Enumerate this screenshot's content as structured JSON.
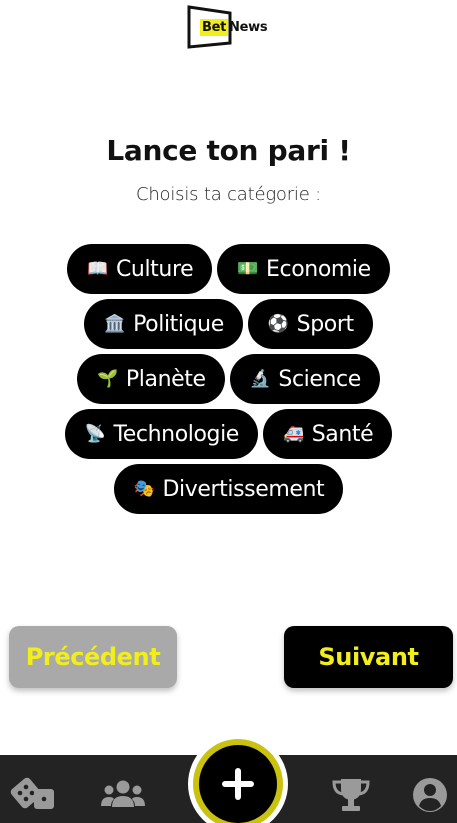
{
  "logo": {
    "bet": "Bet",
    "news": "News"
  },
  "title": "Lance ton pari !",
  "subtitle": "Choisis ta catégorie :",
  "categories": [
    {
      "emoji": "📖",
      "label": "Culture",
      "icon": "open-book-icon"
    },
    {
      "emoji": "💵",
      "label": "Economie",
      "icon": "banknote-icon"
    },
    {
      "emoji": "🏛️",
      "label": "Politique",
      "icon": "classical-building-icon"
    },
    {
      "emoji": "⚽",
      "label": "Sport",
      "icon": "soccer-ball-icon"
    },
    {
      "emoji": "🌱",
      "label": "Planète",
      "icon": "seedling-icon"
    },
    {
      "emoji": "🔬",
      "label": "Science",
      "icon": "microscope-icon"
    },
    {
      "emoji": "📡",
      "label": "Technologie",
      "icon": "satellite-dish-icon"
    },
    {
      "emoji": "🚑",
      "label": "Santé",
      "icon": "ambulance-icon"
    },
    {
      "emoji": "🎭",
      "label": "Divertissement",
      "icon": "theater-masks-icon"
    }
  ],
  "buttons": {
    "previous": "Précédent",
    "next": "Suivant"
  },
  "nav": {
    "items": [
      "dice-icon",
      "users-icon",
      "plus-icon",
      "trophy-icon",
      "user-circle-icon"
    ]
  },
  "colors": {
    "accent": "#f2ee1b",
    "chip_bg": "#000000",
    "prev_bg": "#a9a9a9",
    "nav_bg": "#232323",
    "fab_ring": "#c9c20e"
  }
}
